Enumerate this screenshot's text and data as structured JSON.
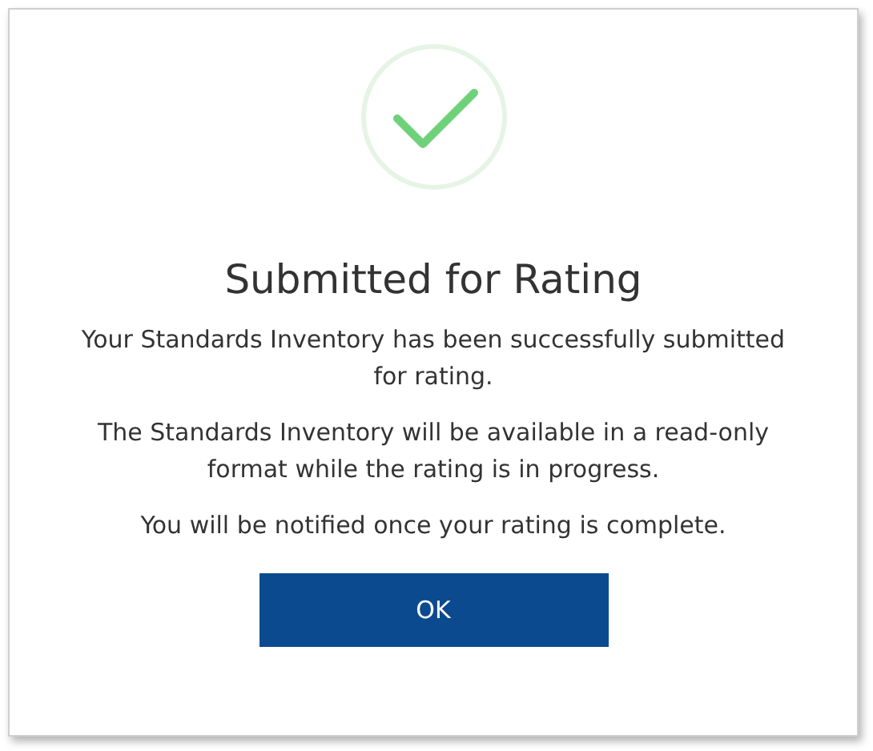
{
  "dialog": {
    "title": "Submitted for Rating",
    "messages": [
      "Your Standards Inventory has been successfully submitted for rating.",
      "The Standards Inventory will be available in a read-only format while the rating is in progress.",
      "You will be notified once your rating is complete."
    ],
    "button": "OK"
  }
}
